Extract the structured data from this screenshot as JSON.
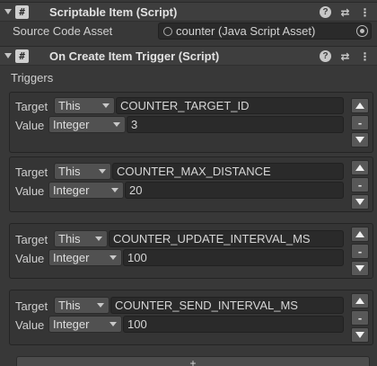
{
  "component1": {
    "title": "Scriptable Item (Script)",
    "script_icon": "#",
    "fields": {
      "source_label": "Source Code Asset",
      "source_value": "counter (Java Script Asset)"
    }
  },
  "component2": {
    "title": "On Create Item Trigger (Script)",
    "script_icon": "#",
    "triggers_label": "Triggers"
  },
  "header_icons": {
    "help": "?",
    "settings": "⇄",
    "menu": "⋮"
  },
  "entry_labels": {
    "target": "Target",
    "value": "Value"
  },
  "entry_buttons": {
    "up": "▲",
    "minus": "-",
    "down": "▼"
  },
  "triggers": [
    {
      "target_type": "This",
      "target_id": "COUNTER_TARGET_ID",
      "value_type": "Integer",
      "value": "3"
    },
    {
      "target_type": "This",
      "target_id": "COUNTER_MAX_DISTANCE",
      "value_type": "Integer",
      "value": "20"
    },
    {
      "target_type": "This",
      "target_id": "COUNTER_UPDATE_INTERVAL_MS",
      "value_type": "Integer",
      "value": "100"
    },
    {
      "target_type": "This",
      "target_id": "COUNTER_SEND_INTERVAL_MS",
      "value_type": "Integer",
      "value": "100"
    }
  ],
  "add_button": "+"
}
